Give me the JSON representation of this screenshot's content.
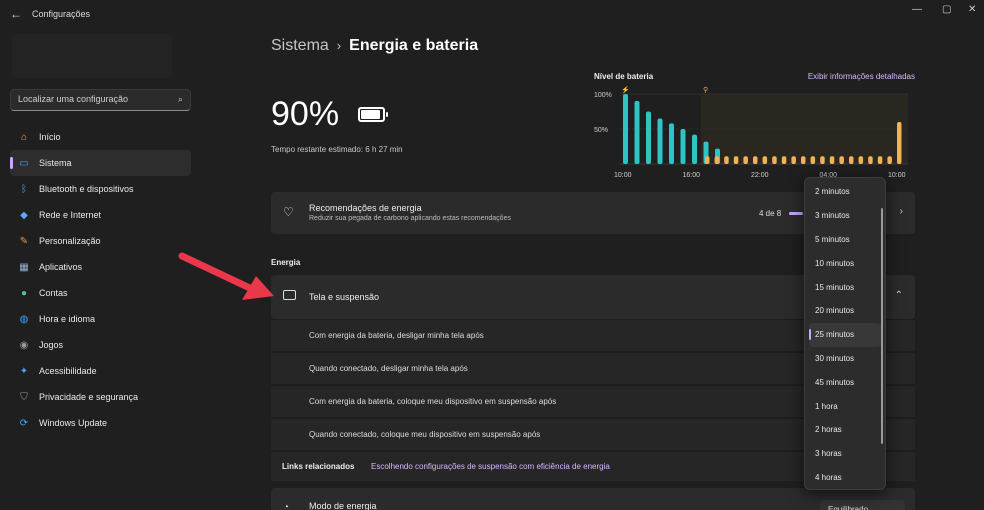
{
  "window": {
    "title": "Configurações",
    "back_glyph": "←",
    "minimize_glyph": "—",
    "maximize_glyph": "▢",
    "close_glyph": "✕"
  },
  "search": {
    "placeholder": "Localizar uma configuração"
  },
  "sidebar": {
    "items": [
      {
        "label": "Início",
        "icon": "home-icon",
        "color": "#f0b35a"
      },
      {
        "label": "Sistema",
        "icon": "system-icon",
        "color": "#3ea6ff",
        "active": true
      },
      {
        "label": "Bluetooth e dispositivos",
        "icon": "bluetooth-icon",
        "color": "#3ea6ff"
      },
      {
        "label": "Rede e Internet",
        "icon": "wifi-icon",
        "color": "#5aa9ff"
      },
      {
        "label": "Personalização",
        "icon": "brush-icon",
        "color": "#e0964a"
      },
      {
        "label": "Aplicativos",
        "icon": "apps-icon",
        "color": "#9ab4d6"
      },
      {
        "label": "Contas",
        "icon": "account-icon",
        "color": "#4cc2a0"
      },
      {
        "label": "Hora e idioma",
        "icon": "globe-clock-icon",
        "color": "#3ea6ff"
      },
      {
        "label": "Jogos",
        "icon": "gamepad-icon",
        "color": "#9a9a9a"
      },
      {
        "label": "Acessibilidade",
        "icon": "accessibility-icon",
        "color": "#3ea6ff"
      },
      {
        "label": "Privacidade e segurança",
        "icon": "shield-icon",
        "color": "#8a9ab0"
      },
      {
        "label": "Windows Update",
        "icon": "update-icon",
        "color": "#3ea6ff"
      }
    ]
  },
  "breadcrumb": {
    "parent": "Sistema",
    "separator": "›",
    "current": "Energia e bateria"
  },
  "battery": {
    "percent": "90%",
    "remaining": "Tempo restante estimado: 6 h 27 min"
  },
  "chart": {
    "title": "Nível de bateria",
    "link": "Exibir informações detalhadas"
  },
  "chart_data": {
    "type": "bar",
    "title": "Nível de bateria",
    "ylim": [
      0,
      100
    ],
    "y_ticks": [
      "100%",
      "50%"
    ],
    "x_ticks": [
      "10:00",
      "16:00",
      "22:00",
      "04:00",
      "10:00"
    ],
    "series": [
      {
        "color": "#2ec4c4",
        "values": [
          100,
          90,
          75,
          65,
          58,
          50,
          42,
          32,
          22
        ]
      },
      {
        "color": "#f0b35a",
        "values": [
          11,
          11,
          11,
          11,
          11,
          11,
          11,
          11,
          11,
          11,
          11,
          11,
          11,
          11,
          11,
          11,
          11,
          11,
          11,
          11,
          60
        ]
      }
    ]
  },
  "recommendations": {
    "title": "Recomendações de energia",
    "subtitle": "Reduzir sua pegada de carbono aplicando estas recomendações",
    "progress": "4 de 8",
    "chevron": "›"
  },
  "energy_section": "Energia",
  "tela": {
    "label": "Tela e suspensão",
    "chevron": "⌃",
    "rows": [
      "Com energia da bateria, desligar minha tela após",
      "Quando conectado, desligar minha tela após",
      "Com energia da bateria, coloque meu dispositivo em suspensão após",
      "Quando conectado, coloque meu dispositivo em suspensão após"
    ]
  },
  "links": {
    "label": "Links relacionados",
    "link": "Escolhendo configurações de suspensão com eficiência de energia"
  },
  "modo": {
    "label": "Modo de energia",
    "value": "Equilibrado"
  },
  "dropdown": {
    "options": [
      "2 minutos",
      "3 minutos",
      "5 minutos",
      "10 minutos",
      "15 minutos",
      "20 minutos",
      "25 minutos",
      "30 minutos",
      "45 minutos",
      "1 hora",
      "2 horas",
      "3 horas",
      "4 horas"
    ],
    "selected_index": 6
  },
  "colors": {
    "accent": "#c9a6ff",
    "annotation_arrow": "#e8384a"
  }
}
